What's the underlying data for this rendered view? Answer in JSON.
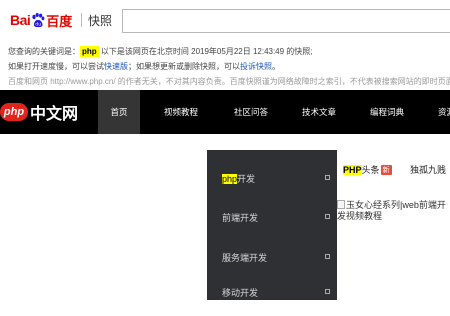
{
  "baidu": {
    "logo_bai": "Bai",
    "logo_du": "du",
    "logo_word": "百度",
    "snapshot_label": "快照",
    "search_value": "",
    "line1_prefix": "您查询的关键词是：",
    "keyword": "php",
    "line1_suffix": "以下是该网页在北京时间 2019年05月22日 12:43:49 的快照;",
    "line2_prefix": "如果打开速度慢，可以尝试",
    "line2_link1": "快速版",
    "line2_middle": "；如果想更新或删除快照，可以",
    "line2_link2": "投诉快照",
    "line2_end": "。",
    "line3": "百度和网页 http://www.php.cn/ 的作者无关，不对其内容负责。百度快照谨为网络故障时之索引，不代表被搜索网站的即时页面。"
  },
  "site": {
    "logo_badge": "php",
    "logo_cn": "中文网",
    "nav": [
      {
        "label": "首页",
        "active": true
      },
      {
        "label": "视频教程"
      },
      {
        "label": "社区问答"
      },
      {
        "label": "技术文章"
      },
      {
        "label": "编程词典"
      },
      {
        "label": "资源"
      }
    ],
    "categories": [
      {
        "hl": "php",
        "rest": "开发"
      },
      {
        "label": "前端开发"
      },
      {
        "label": "服务端开发"
      },
      {
        "label": "移动开发"
      }
    ],
    "news_tabs": {
      "tab1_hl": "PHP",
      "tab1_rest": "头条",
      "tab1_badge": "新",
      "tab2": "独孤九贱"
    },
    "article_title": "玉女心经系列|web前端开发视频教程"
  },
  "colors": {
    "baidu_red": "#e10602",
    "baidu_blue": "#2319dc",
    "keyword_highlight": "#ffff00",
    "nav_bg": "#000000",
    "dropdown_bg": "#2e3033",
    "php_red": "#e0261b"
  },
  "icons": {
    "baidu_paw": "paw-icon",
    "dropdown_arrow": "square-arrow-icon",
    "broken_image": "broken-image-icon"
  }
}
